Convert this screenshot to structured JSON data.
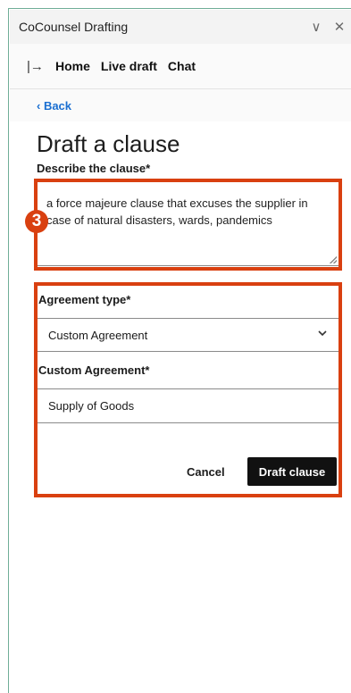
{
  "window": {
    "title": "CoCounsel Drafting",
    "menu_glyph": "∨",
    "close_glyph": "✕"
  },
  "nav": {
    "collapse_glyph": "|→",
    "items": [
      "Home",
      "Live draft",
      "Chat"
    ]
  },
  "back": {
    "label": "‹  Back"
  },
  "page": {
    "title": "Draft a clause"
  },
  "form": {
    "describe_label": "Describe the clause*",
    "describe_value": "a force majeure clause that excuses the supplier in case of natural disasters, wards, pandemics",
    "agreement_type_label": "Agreement type*",
    "agreement_type_value": "Custom Agreement",
    "custom_agreement_label": "Custom Agreement*",
    "custom_agreement_value": "Supply of Goods",
    "cancel_label": "Cancel",
    "submit_label": "Draft clause"
  },
  "annotation": {
    "step_number": "3",
    "color": "#d94010"
  },
  "icons": {
    "collapse": "collapse-panel-icon",
    "dropdown": "chevron-down-icon",
    "window_menu": "chevron-down-icon",
    "close": "close-icon",
    "back": "chevron-left-icon"
  },
  "colors": {
    "accent_link": "#1a6fd1",
    "primary_button": "#111111",
    "frame_border": "#6fae97"
  }
}
